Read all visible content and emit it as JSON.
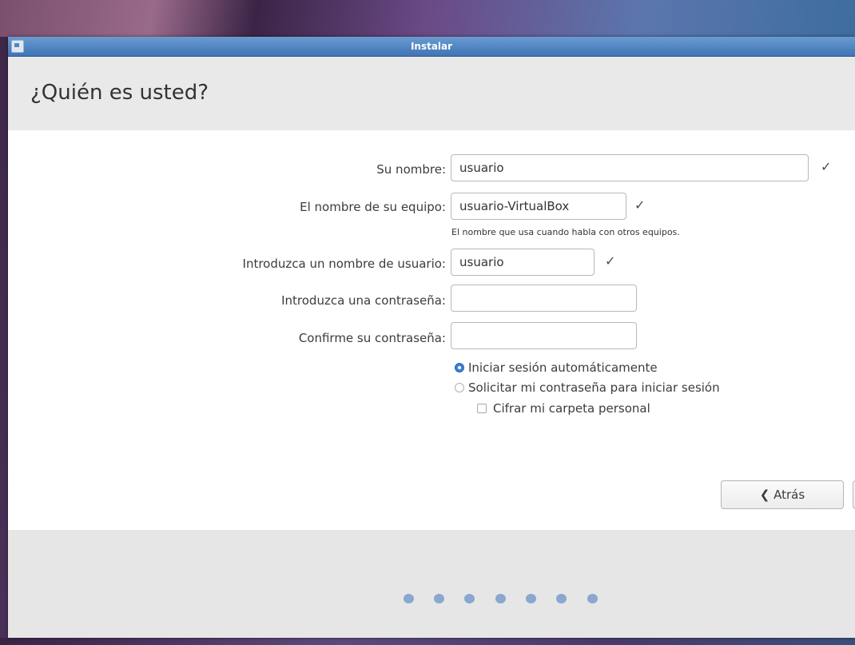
{
  "window": {
    "title": "Instalar"
  },
  "header": {
    "heading": "¿Quién es usted?"
  },
  "form": {
    "name": {
      "label": "Su nombre:",
      "value": "usuario",
      "valid": true
    },
    "computer": {
      "label": "El nombre de su equipo:",
      "value": "usuario-VirtualBox",
      "valid": true,
      "hint": "El nombre que usa cuando habla con otros equipos."
    },
    "username": {
      "label": "Introduzca un nombre de usuario:",
      "value": "usuario",
      "valid": true
    },
    "password": {
      "label": "Introduzca una contraseña:",
      "value": ""
    },
    "confirm": {
      "label": "Confirme su contraseña:",
      "value": ""
    },
    "login_options": [
      {
        "label": "Iniciar sesión automáticamente",
        "selected": true
      },
      {
        "label": "Solicitar mi contraseña para iniciar sesión",
        "selected": false
      }
    ],
    "encrypt": {
      "label": "Cifrar mi carpeta personal",
      "checked": false
    }
  },
  "buttons": {
    "back": "❮ Atrás"
  },
  "check_glyph": "✓",
  "progress": {
    "steps": 7
  },
  "colors": {
    "accent": "#3d7fd6",
    "dots": "#89a7cf",
    "titlebar": "#4a80c0"
  },
  "icons": {
    "app": "installer-icon",
    "valid": "checkmark-icon",
    "back": "chevron-left-icon"
  }
}
